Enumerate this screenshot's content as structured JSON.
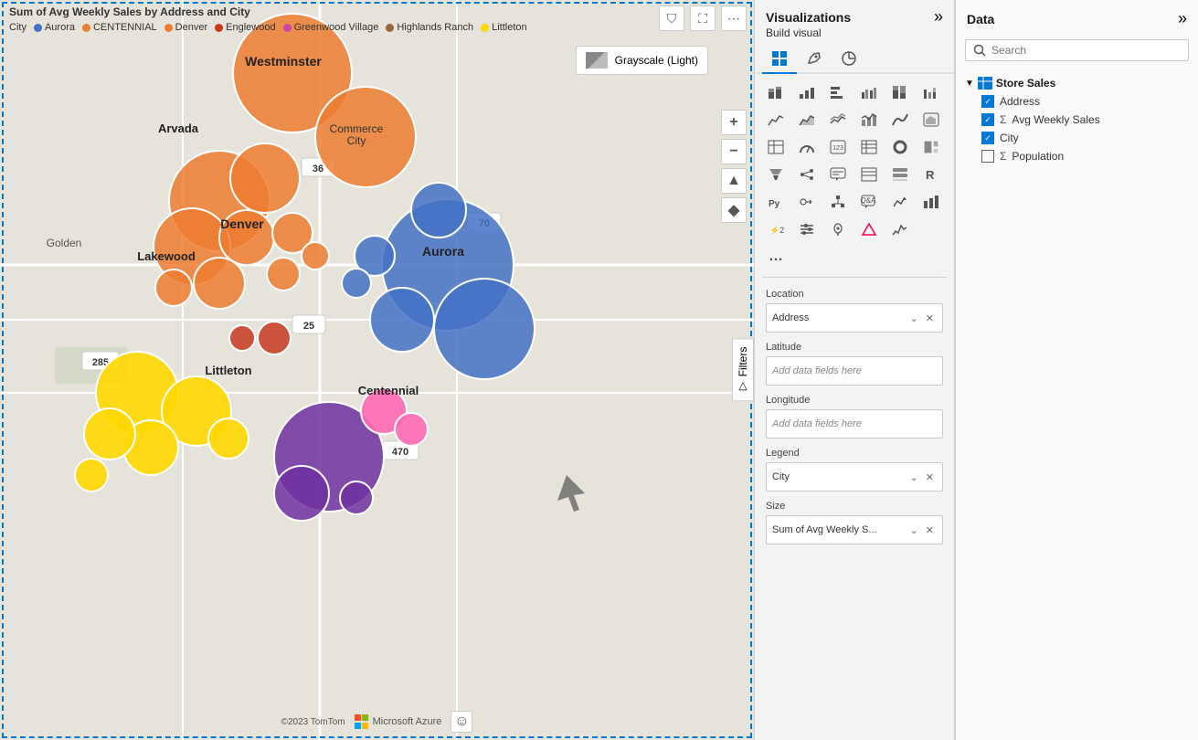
{
  "map": {
    "title": "Sum of Avg Weekly Sales by Address and City",
    "style_selector": "Grayscale (Light)",
    "attribution": "©2023 TomTom",
    "azure_label": "Microsoft Azure",
    "legend_label": "City",
    "filters_tab": "Filters",
    "legend_items": [
      {
        "label": "Aurora",
        "color": "#4472C4"
      },
      {
        "label": "CENTENNIAL",
        "color": "#ED7D31"
      },
      {
        "label": "Denver",
        "color": "#ED7D31"
      },
      {
        "label": "Englewood",
        "color": "#c8391f"
      },
      {
        "label": "Greenwood Village",
        "color": "#cc44aa"
      },
      {
        "label": "Highlands Ranch",
        "color": "#996644"
      },
      {
        "label": "Littleton",
        "color": "#FFD700"
      }
    ]
  },
  "toolbar": {
    "filter_icon": "⛉",
    "focus_icon": "⛶",
    "more_icon": "⋯",
    "plus_icon": "+",
    "minus_icon": "−",
    "compass_icon": "▲",
    "diamond_icon": "◆",
    "smiley_icon": "☺"
  },
  "visualizations_panel": {
    "title": "Visualizations",
    "build_visual_label": "Build visual",
    "tabs": [
      {
        "label": "chart-tab",
        "icon": "▦",
        "active": true
      },
      {
        "label": "format-tab",
        "icon": "🖌",
        "active": false
      },
      {
        "label": "analytics-tab",
        "icon": "📊",
        "active": false
      }
    ],
    "icon_grid": [
      "▦",
      "📊",
      "▤",
      "📊",
      "▦",
      "▦",
      "📈",
      "🏔",
      "📉",
      "📊",
      "📉",
      "🗺",
      "▤",
      "🎨",
      "📋",
      "📊",
      "🥧",
      "▦",
      "📊",
      "🗂",
      "📊",
      "🔘",
      "🗺",
      "123",
      "▦",
      "🎯",
      "🗂",
      "▦",
      "▦",
      "R",
      "Py",
      "🗂",
      "🗂",
      "💬",
      "📋",
      "🏆",
      "📊",
      "⚡",
      "🔢",
      "📍",
      "🔴",
      "〰",
      "..."
    ],
    "map_icon_index": 17,
    "field_wells": {
      "location": {
        "label": "Location",
        "value": "Address",
        "has_chevron": true,
        "has_x": true
      },
      "latitude": {
        "label": "Latitude",
        "placeholder": "Add data fields here"
      },
      "longitude": {
        "label": "Longitude",
        "placeholder": "Add data fields here"
      },
      "legend": {
        "label": "Legend",
        "value": "City",
        "has_chevron": true,
        "has_x": true
      },
      "size": {
        "label": "Size",
        "value": "Sum of Avg Weekly S...",
        "has_chevron": true,
        "has_x": true
      }
    }
  },
  "data_panel": {
    "title": "Data",
    "search_placeholder": "Search",
    "dataset": {
      "name": "Store Sales",
      "fields": [
        {
          "label": "Address",
          "checked": true,
          "is_measure": false
        },
        {
          "label": "Avg Weekly Sales",
          "checked": true,
          "is_measure": true
        },
        {
          "label": "City",
          "checked": true,
          "is_measure": false
        },
        {
          "label": "Population",
          "checked": false,
          "is_measure": true
        }
      ]
    }
  },
  "cities": {
    "labels": [
      "Westminster",
      "Arvada",
      "Commerce City",
      "Denver",
      "Lakewood",
      "Aurora",
      "Littleton",
      "Centennial",
      "Golden"
    ]
  }
}
